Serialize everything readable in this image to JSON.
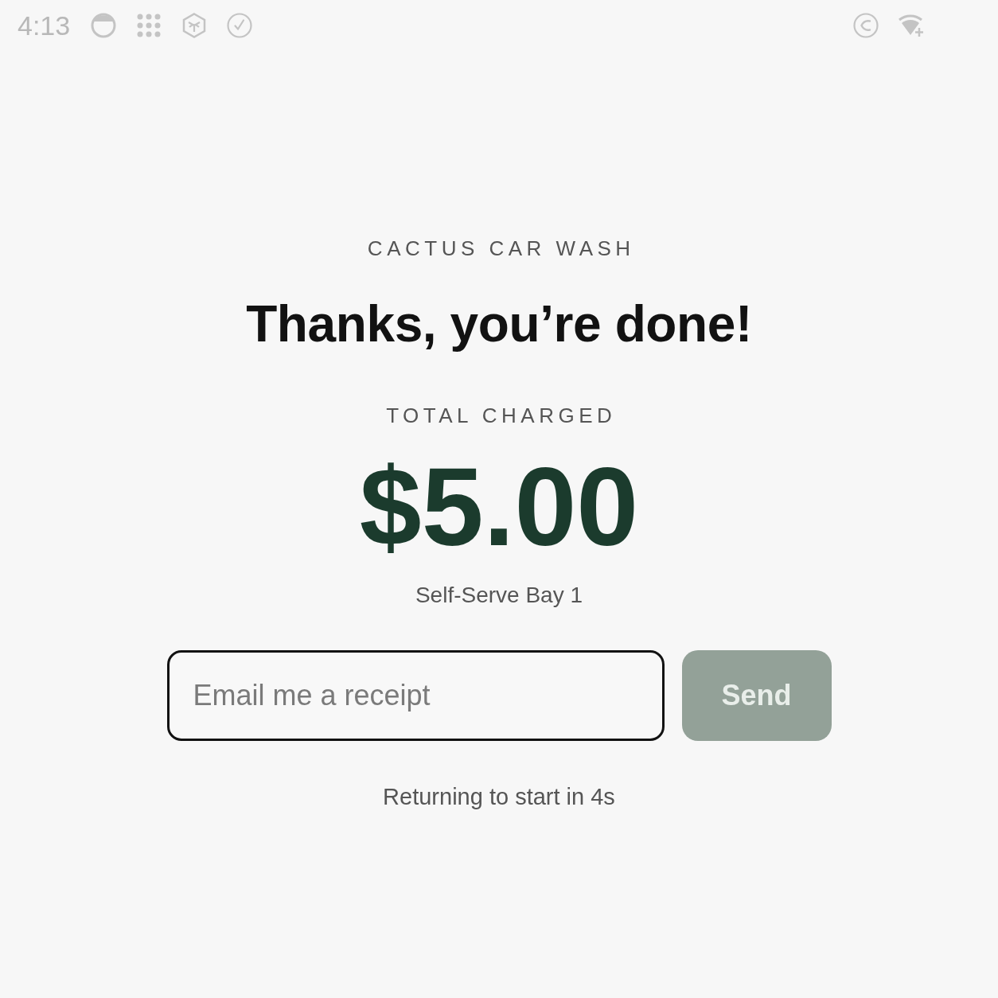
{
  "status_bar": {
    "time": "4:13"
  },
  "header": {
    "brand": "CACTUS CAR WASH",
    "title": "Thanks, you’re done!"
  },
  "summary": {
    "label": "TOTAL CHARGED",
    "amount": "$5.00",
    "location": "Self-Serve Bay 1"
  },
  "receipt": {
    "email_field": {
      "placeholder": "Email me a receipt"
    },
    "send_button": {
      "label": "Send",
      "disabled": true
    }
  },
  "footer": {
    "countdown": "Returning to start in 4s"
  }
}
